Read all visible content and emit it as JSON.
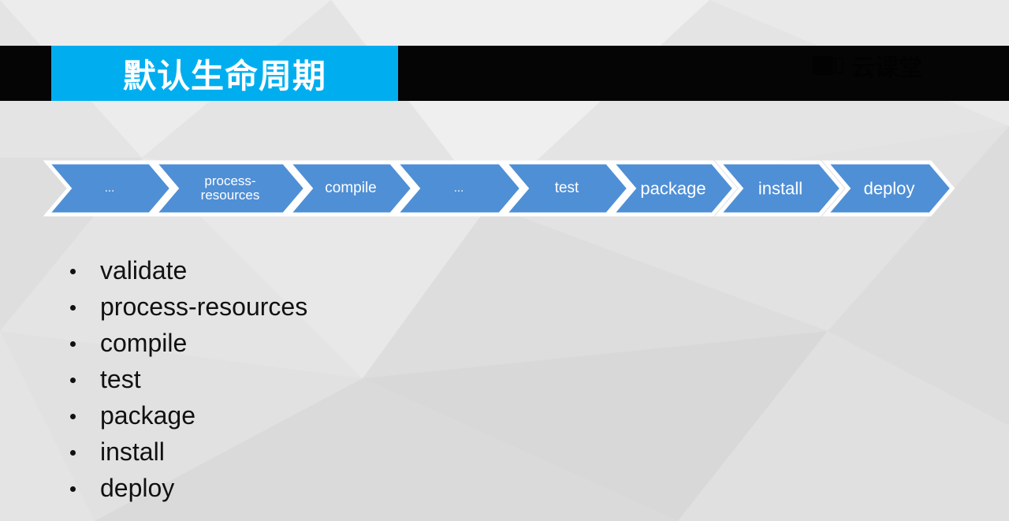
{
  "title": "默认生命周期",
  "logo_text": "云课堂",
  "colors": {
    "title_bar": "#050505",
    "title_box": "#00aeef",
    "chevron_fill": "#4f8fd6",
    "chevron_outline": "#ffffff"
  },
  "chevrons": [
    {
      "label": "..."
    },
    {
      "label": "process-\nresources"
    },
    {
      "label": "compile"
    },
    {
      "label": "..."
    },
    {
      "label": "test"
    },
    {
      "label": "package"
    },
    {
      "label": "install"
    },
    {
      "label": "deploy"
    }
  ],
  "bullets": [
    "validate",
    "process-resources",
    "compile",
    "test",
    "package",
    "install",
    "deploy"
  ]
}
